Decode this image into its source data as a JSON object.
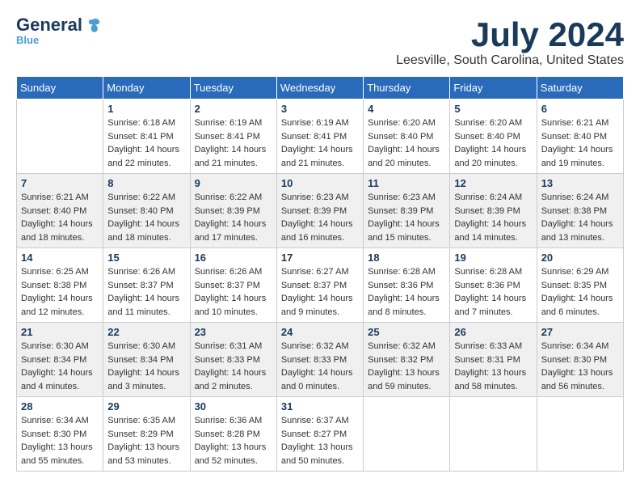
{
  "logo": {
    "general": "General",
    "blue": "Blue",
    "bird_symbol": "🐦"
  },
  "title": {
    "month_year": "July 2024",
    "location": "Leesville, South Carolina, United States"
  },
  "weekdays": [
    "Sunday",
    "Monday",
    "Tuesday",
    "Wednesday",
    "Thursday",
    "Friday",
    "Saturday"
  ],
  "weeks": [
    [
      {
        "day": null,
        "info": null
      },
      {
        "day": "1",
        "info": "Sunrise: 6:18 AM\nSunset: 8:41 PM\nDaylight: 14 hours\nand 22 minutes."
      },
      {
        "day": "2",
        "info": "Sunrise: 6:19 AM\nSunset: 8:41 PM\nDaylight: 14 hours\nand 21 minutes."
      },
      {
        "day": "3",
        "info": "Sunrise: 6:19 AM\nSunset: 8:41 PM\nDaylight: 14 hours\nand 21 minutes."
      },
      {
        "day": "4",
        "info": "Sunrise: 6:20 AM\nSunset: 8:40 PM\nDaylight: 14 hours\nand 20 minutes."
      },
      {
        "day": "5",
        "info": "Sunrise: 6:20 AM\nSunset: 8:40 PM\nDaylight: 14 hours\nand 20 minutes."
      },
      {
        "day": "6",
        "info": "Sunrise: 6:21 AM\nSunset: 8:40 PM\nDaylight: 14 hours\nand 19 minutes."
      }
    ],
    [
      {
        "day": "7",
        "info": "Sunrise: 6:21 AM\nSunset: 8:40 PM\nDaylight: 14 hours\nand 18 minutes."
      },
      {
        "day": "8",
        "info": "Sunrise: 6:22 AM\nSunset: 8:40 PM\nDaylight: 14 hours\nand 18 minutes."
      },
      {
        "day": "9",
        "info": "Sunrise: 6:22 AM\nSunset: 8:39 PM\nDaylight: 14 hours\nand 17 minutes."
      },
      {
        "day": "10",
        "info": "Sunrise: 6:23 AM\nSunset: 8:39 PM\nDaylight: 14 hours\nand 16 minutes."
      },
      {
        "day": "11",
        "info": "Sunrise: 6:23 AM\nSunset: 8:39 PM\nDaylight: 14 hours\nand 15 minutes."
      },
      {
        "day": "12",
        "info": "Sunrise: 6:24 AM\nSunset: 8:39 PM\nDaylight: 14 hours\nand 14 minutes."
      },
      {
        "day": "13",
        "info": "Sunrise: 6:24 AM\nSunset: 8:38 PM\nDaylight: 14 hours\nand 13 minutes."
      }
    ],
    [
      {
        "day": "14",
        "info": "Sunrise: 6:25 AM\nSunset: 8:38 PM\nDaylight: 14 hours\nand 12 minutes."
      },
      {
        "day": "15",
        "info": "Sunrise: 6:26 AM\nSunset: 8:37 PM\nDaylight: 14 hours\nand 11 minutes."
      },
      {
        "day": "16",
        "info": "Sunrise: 6:26 AM\nSunset: 8:37 PM\nDaylight: 14 hours\nand 10 minutes."
      },
      {
        "day": "17",
        "info": "Sunrise: 6:27 AM\nSunset: 8:37 PM\nDaylight: 14 hours\nand 9 minutes."
      },
      {
        "day": "18",
        "info": "Sunrise: 6:28 AM\nSunset: 8:36 PM\nDaylight: 14 hours\nand 8 minutes."
      },
      {
        "day": "19",
        "info": "Sunrise: 6:28 AM\nSunset: 8:36 PM\nDaylight: 14 hours\nand 7 minutes."
      },
      {
        "day": "20",
        "info": "Sunrise: 6:29 AM\nSunset: 8:35 PM\nDaylight: 14 hours\nand 6 minutes."
      }
    ],
    [
      {
        "day": "21",
        "info": "Sunrise: 6:30 AM\nSunset: 8:34 PM\nDaylight: 14 hours\nand 4 minutes."
      },
      {
        "day": "22",
        "info": "Sunrise: 6:30 AM\nSunset: 8:34 PM\nDaylight: 14 hours\nand 3 minutes."
      },
      {
        "day": "23",
        "info": "Sunrise: 6:31 AM\nSunset: 8:33 PM\nDaylight: 14 hours\nand 2 minutes."
      },
      {
        "day": "24",
        "info": "Sunrise: 6:32 AM\nSunset: 8:33 PM\nDaylight: 14 hours\nand 0 minutes."
      },
      {
        "day": "25",
        "info": "Sunrise: 6:32 AM\nSunset: 8:32 PM\nDaylight: 13 hours\nand 59 minutes."
      },
      {
        "day": "26",
        "info": "Sunrise: 6:33 AM\nSunset: 8:31 PM\nDaylight: 13 hours\nand 58 minutes."
      },
      {
        "day": "27",
        "info": "Sunrise: 6:34 AM\nSunset: 8:30 PM\nDaylight: 13 hours\nand 56 minutes."
      }
    ],
    [
      {
        "day": "28",
        "info": "Sunrise: 6:34 AM\nSunset: 8:30 PM\nDaylight: 13 hours\nand 55 minutes."
      },
      {
        "day": "29",
        "info": "Sunrise: 6:35 AM\nSunset: 8:29 PM\nDaylight: 13 hours\nand 53 minutes."
      },
      {
        "day": "30",
        "info": "Sunrise: 6:36 AM\nSunset: 8:28 PM\nDaylight: 13 hours\nand 52 minutes."
      },
      {
        "day": "31",
        "info": "Sunrise: 6:37 AM\nSunset: 8:27 PM\nDaylight: 13 hours\nand 50 minutes."
      },
      {
        "day": null,
        "info": null
      },
      {
        "day": null,
        "info": null
      },
      {
        "day": null,
        "info": null
      }
    ]
  ]
}
